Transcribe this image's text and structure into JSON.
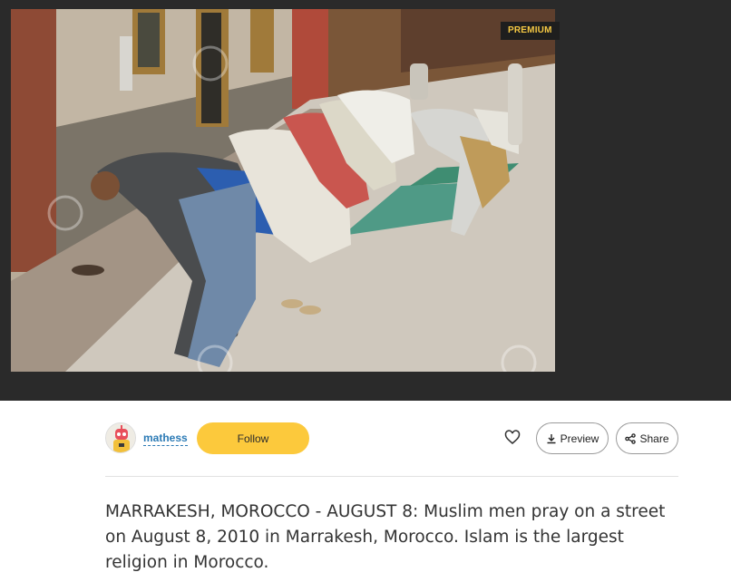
{
  "image": {
    "badge": "PREMIUM",
    "watermark": "123RF"
  },
  "author": {
    "name": "mathess",
    "avatar_icon": "robot-avatar-icon"
  },
  "actions": {
    "follow_label": "Follow",
    "like_icon": "heart-icon",
    "preview_label": "Preview",
    "preview_icon": "download-icon",
    "share_label": "Share",
    "share_icon": "share-icon"
  },
  "caption": "MARRAKESH, MOROCCO - AUGUST 8: Muslim men pray on a street on August 8, 2010 in Marrakesh, Morocco. Islam is the largest religion in Morocco.",
  "colors": {
    "viewer_bg": "#2a2a2a",
    "badge_text": "#f5c843",
    "follow_bg": "#fcc93c",
    "link": "#2b7ab5"
  }
}
